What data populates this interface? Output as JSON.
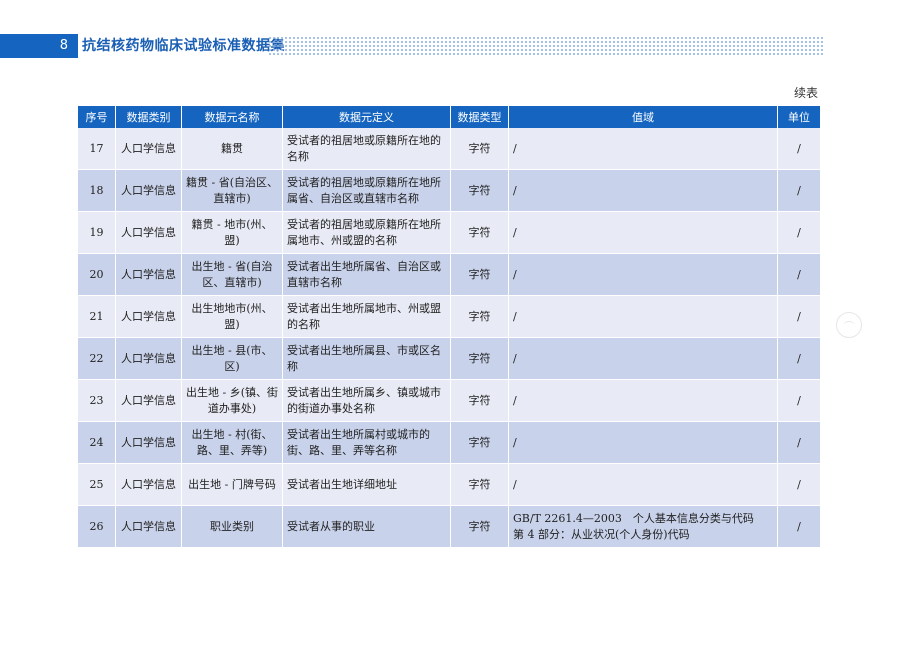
{
  "header": {
    "page_number": "8",
    "book_title": "抗结核药物临床试验标准数据集"
  },
  "continued_label": "续表",
  "table": {
    "columns": [
      "序号",
      "数据类别",
      "数据元名称",
      "数据元定义",
      "数据类型",
      "值域",
      "单位"
    ],
    "rows": [
      {
        "no": "17",
        "category": "人口学信息",
        "name": "籍贯",
        "definition": "受试者的祖居地或原籍所在地的名称",
        "type": "字符",
        "domain": "/",
        "unit": "/"
      },
      {
        "no": "18",
        "category": "人口学信息",
        "name": "籍贯 - 省(自治区、直辖市)",
        "definition": "受试者的祖居地或原籍所在地所属省、自治区或直辖市名称",
        "type": "字符",
        "domain": "/",
        "unit": "/"
      },
      {
        "no": "19",
        "category": "人口学信息",
        "name": "籍贯 - 地市(州、盟)",
        "definition": "受试者的祖居地或原籍所在地所属地市、州或盟的名称",
        "type": "字符",
        "domain": "/",
        "unit": "/"
      },
      {
        "no": "20",
        "category": "人口学信息",
        "name": "出生地 - 省(自治区、直辖市)",
        "definition": "受试者出生地所属省、自治区或直辖市名称",
        "type": "字符",
        "domain": "/",
        "unit": "/"
      },
      {
        "no": "21",
        "category": "人口学信息",
        "name": "出生地地市(州、盟)",
        "definition": "受试者出生地所属地市、州或盟的名称",
        "type": "字符",
        "domain": "/",
        "unit": "/"
      },
      {
        "no": "22",
        "category": "人口学信息",
        "name": "出生地 - 县(市、区)",
        "definition": "受试者出生地所属县、市或区名称",
        "type": "字符",
        "domain": "/",
        "unit": "/"
      },
      {
        "no": "23",
        "category": "人口学信息",
        "name": "出生地 - 乡(镇、街道办事处)",
        "definition": "受试者出生地所属乡、镇或城市的街道办事处名称",
        "type": "字符",
        "domain": "/",
        "unit": "/"
      },
      {
        "no": "24",
        "category": "人口学信息",
        "name": "出生地 - 村(街、路、里、弄等)",
        "definition": "受试者出生地所属村或城市的街、路、里、弄等名称",
        "type": "字符",
        "domain": "/",
        "unit": "/"
      },
      {
        "no": "25",
        "category": "人口学信息",
        "name": "出生地 - 门牌号码",
        "definition": "受试者出生地详细地址",
        "type": "字符",
        "domain": "/",
        "unit": "/"
      },
      {
        "no": "26",
        "category": "人口学信息",
        "name": "职业类别",
        "definition": "受试者从事的职业",
        "type": "字符",
        "domain": "GB/T 2261.4—2003　个人基本信息分类与代码　第 4 部分：从业状况(个人身份)代码",
        "unit": "/"
      }
    ]
  }
}
